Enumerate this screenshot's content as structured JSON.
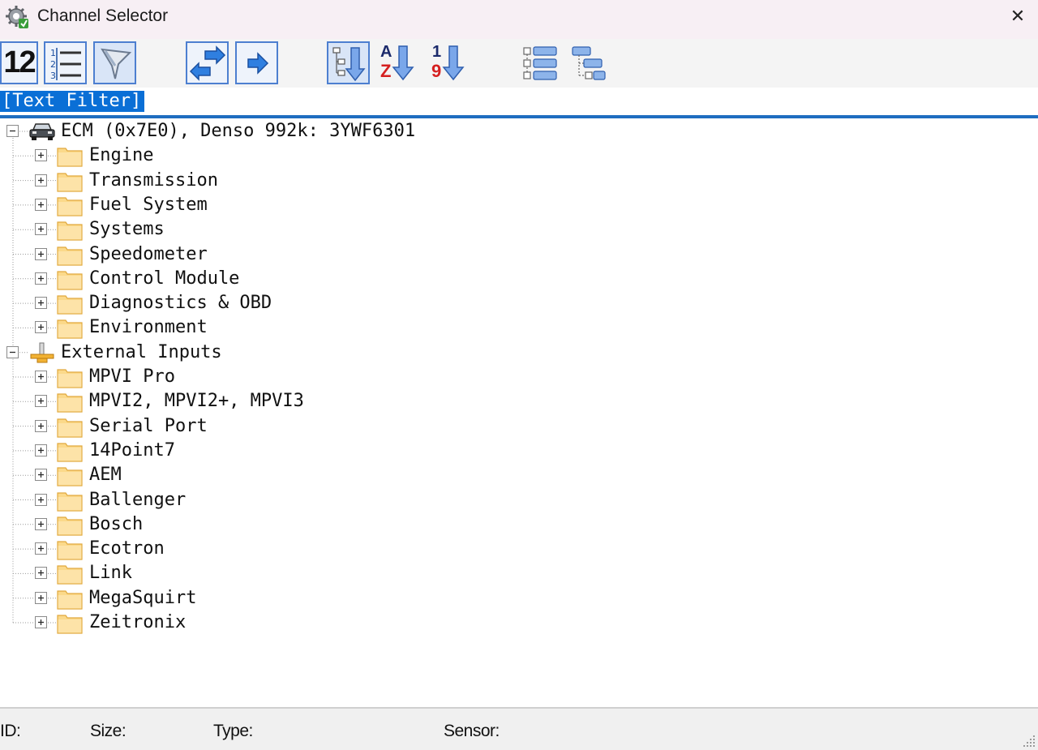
{
  "window": {
    "title": "Channel Selector",
    "close_glyph": "✕"
  },
  "toolbar": {
    "buttons": [
      {
        "name": "show-ids-button",
        "icon": "numbers-12-icon",
        "text": "12"
      },
      {
        "name": "list-view-button",
        "icon": "numbered-list-icon",
        "text": ""
      },
      {
        "name": "filter-button",
        "icon": "filter-funnel-icon",
        "text": ""
      },
      {
        "name": "swap-button",
        "icon": "swap-arrows-icon",
        "text": ""
      },
      {
        "name": "goto-button",
        "icon": "right-arrow-icon",
        "text": ""
      },
      {
        "name": "sort-tree-button",
        "icon": "sort-tree-down-icon",
        "text": ""
      },
      {
        "name": "sort-alpha-button",
        "icon": "sort-a-z-icon",
        "text": "A Z"
      },
      {
        "name": "sort-numeric-button",
        "icon": "sort-1-9-icon",
        "text": "1 9"
      },
      {
        "name": "expand-all-button",
        "icon": "expand-tree-icon",
        "text": ""
      },
      {
        "name": "collapse-all-button",
        "icon": "collapse-tree-icon",
        "text": ""
      }
    ],
    "sort_alpha_letters": [
      "A",
      "Z"
    ],
    "sort_numeric_digits": [
      "1",
      "9"
    ],
    "ids_digits": "12"
  },
  "filter": {
    "placeholder": "[Text Filter]",
    "selected_text": "[Text Filter]"
  },
  "tree": {
    "root_ecm": {
      "label": "ECM (0x7E0), Denso 992k: 3YWF6301",
      "icon": "car-icon",
      "children": [
        "Engine",
        "Transmission",
        "Fuel System",
        "Systems",
        "Speedometer",
        "Control Module",
        "Diagnostics & OBD",
        "Environment"
      ]
    },
    "root_external": {
      "label": "External Inputs",
      "icon": "plug-connector-icon",
      "children": [
        "MPVI Pro",
        "MPVI2, MPVI2+, MPVI3",
        "Serial Port",
        "14Point7",
        "AEM",
        "Ballenger",
        "Bosch",
        "Ecotron",
        "Link",
        "MegaSquirt",
        "Zeitronix"
      ]
    }
  },
  "status": {
    "id_label": "ID:",
    "size_label": "Size:",
    "type_label": "Type:",
    "sensor_label": "Sensor:"
  },
  "colors": {
    "accent_blue": "#1e6dc0",
    "selection_blue": "#0a6fd6",
    "folder_yellow": "#fbd98a",
    "folder_edge": "#e1a93d",
    "titlebar_bg": "#f7eff4"
  }
}
